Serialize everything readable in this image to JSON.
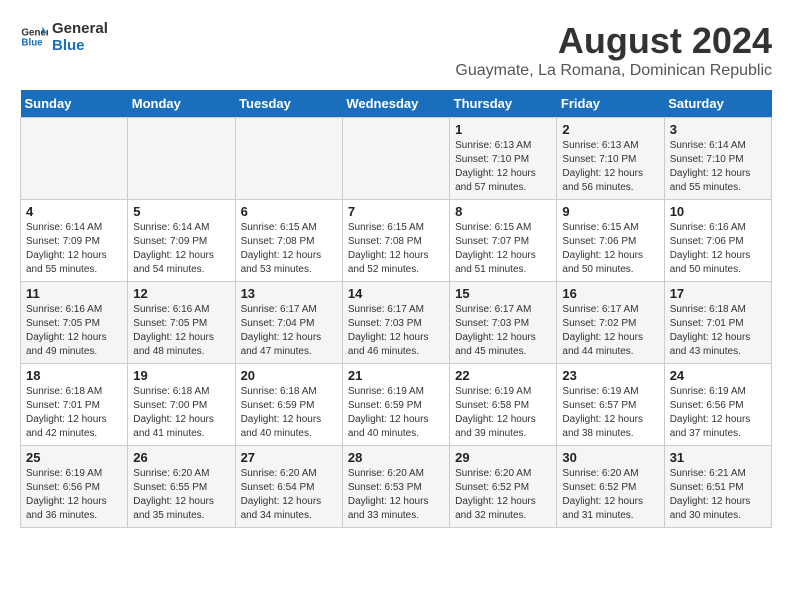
{
  "header": {
    "logo_general": "General",
    "logo_blue": "Blue",
    "main_title": "August 2024",
    "subtitle": "Guaymate, La Romana, Dominican Republic"
  },
  "days_of_week": [
    "Sunday",
    "Monday",
    "Tuesday",
    "Wednesday",
    "Thursday",
    "Friday",
    "Saturday"
  ],
  "weeks": [
    [
      {
        "day": "",
        "info": ""
      },
      {
        "day": "",
        "info": ""
      },
      {
        "day": "",
        "info": ""
      },
      {
        "day": "",
        "info": ""
      },
      {
        "day": "1",
        "info": "Sunrise: 6:13 AM\nSunset: 7:10 PM\nDaylight: 12 hours\nand 57 minutes."
      },
      {
        "day": "2",
        "info": "Sunrise: 6:13 AM\nSunset: 7:10 PM\nDaylight: 12 hours\nand 56 minutes."
      },
      {
        "day": "3",
        "info": "Sunrise: 6:14 AM\nSunset: 7:10 PM\nDaylight: 12 hours\nand 55 minutes."
      }
    ],
    [
      {
        "day": "4",
        "info": "Sunrise: 6:14 AM\nSunset: 7:09 PM\nDaylight: 12 hours\nand 55 minutes."
      },
      {
        "day": "5",
        "info": "Sunrise: 6:14 AM\nSunset: 7:09 PM\nDaylight: 12 hours\nand 54 minutes."
      },
      {
        "day": "6",
        "info": "Sunrise: 6:15 AM\nSunset: 7:08 PM\nDaylight: 12 hours\nand 53 minutes."
      },
      {
        "day": "7",
        "info": "Sunrise: 6:15 AM\nSunset: 7:08 PM\nDaylight: 12 hours\nand 52 minutes."
      },
      {
        "day": "8",
        "info": "Sunrise: 6:15 AM\nSunset: 7:07 PM\nDaylight: 12 hours\nand 51 minutes."
      },
      {
        "day": "9",
        "info": "Sunrise: 6:15 AM\nSunset: 7:06 PM\nDaylight: 12 hours\nand 50 minutes."
      },
      {
        "day": "10",
        "info": "Sunrise: 6:16 AM\nSunset: 7:06 PM\nDaylight: 12 hours\nand 50 minutes."
      }
    ],
    [
      {
        "day": "11",
        "info": "Sunrise: 6:16 AM\nSunset: 7:05 PM\nDaylight: 12 hours\nand 49 minutes."
      },
      {
        "day": "12",
        "info": "Sunrise: 6:16 AM\nSunset: 7:05 PM\nDaylight: 12 hours\nand 48 minutes."
      },
      {
        "day": "13",
        "info": "Sunrise: 6:17 AM\nSunset: 7:04 PM\nDaylight: 12 hours\nand 47 minutes."
      },
      {
        "day": "14",
        "info": "Sunrise: 6:17 AM\nSunset: 7:03 PM\nDaylight: 12 hours\nand 46 minutes."
      },
      {
        "day": "15",
        "info": "Sunrise: 6:17 AM\nSunset: 7:03 PM\nDaylight: 12 hours\nand 45 minutes."
      },
      {
        "day": "16",
        "info": "Sunrise: 6:17 AM\nSunset: 7:02 PM\nDaylight: 12 hours\nand 44 minutes."
      },
      {
        "day": "17",
        "info": "Sunrise: 6:18 AM\nSunset: 7:01 PM\nDaylight: 12 hours\nand 43 minutes."
      }
    ],
    [
      {
        "day": "18",
        "info": "Sunrise: 6:18 AM\nSunset: 7:01 PM\nDaylight: 12 hours\nand 42 minutes."
      },
      {
        "day": "19",
        "info": "Sunrise: 6:18 AM\nSunset: 7:00 PM\nDaylight: 12 hours\nand 41 minutes."
      },
      {
        "day": "20",
        "info": "Sunrise: 6:18 AM\nSunset: 6:59 PM\nDaylight: 12 hours\nand 40 minutes."
      },
      {
        "day": "21",
        "info": "Sunrise: 6:19 AM\nSunset: 6:59 PM\nDaylight: 12 hours\nand 40 minutes."
      },
      {
        "day": "22",
        "info": "Sunrise: 6:19 AM\nSunset: 6:58 PM\nDaylight: 12 hours\nand 39 minutes."
      },
      {
        "day": "23",
        "info": "Sunrise: 6:19 AM\nSunset: 6:57 PM\nDaylight: 12 hours\nand 38 minutes."
      },
      {
        "day": "24",
        "info": "Sunrise: 6:19 AM\nSunset: 6:56 PM\nDaylight: 12 hours\nand 37 minutes."
      }
    ],
    [
      {
        "day": "25",
        "info": "Sunrise: 6:19 AM\nSunset: 6:56 PM\nDaylight: 12 hours\nand 36 minutes."
      },
      {
        "day": "26",
        "info": "Sunrise: 6:20 AM\nSunset: 6:55 PM\nDaylight: 12 hours\nand 35 minutes."
      },
      {
        "day": "27",
        "info": "Sunrise: 6:20 AM\nSunset: 6:54 PM\nDaylight: 12 hours\nand 34 minutes."
      },
      {
        "day": "28",
        "info": "Sunrise: 6:20 AM\nSunset: 6:53 PM\nDaylight: 12 hours\nand 33 minutes."
      },
      {
        "day": "29",
        "info": "Sunrise: 6:20 AM\nSunset: 6:52 PM\nDaylight: 12 hours\nand 32 minutes."
      },
      {
        "day": "30",
        "info": "Sunrise: 6:20 AM\nSunset: 6:52 PM\nDaylight: 12 hours\nand 31 minutes."
      },
      {
        "day": "31",
        "info": "Sunrise: 6:21 AM\nSunset: 6:51 PM\nDaylight: 12 hours\nand 30 minutes."
      }
    ]
  ]
}
